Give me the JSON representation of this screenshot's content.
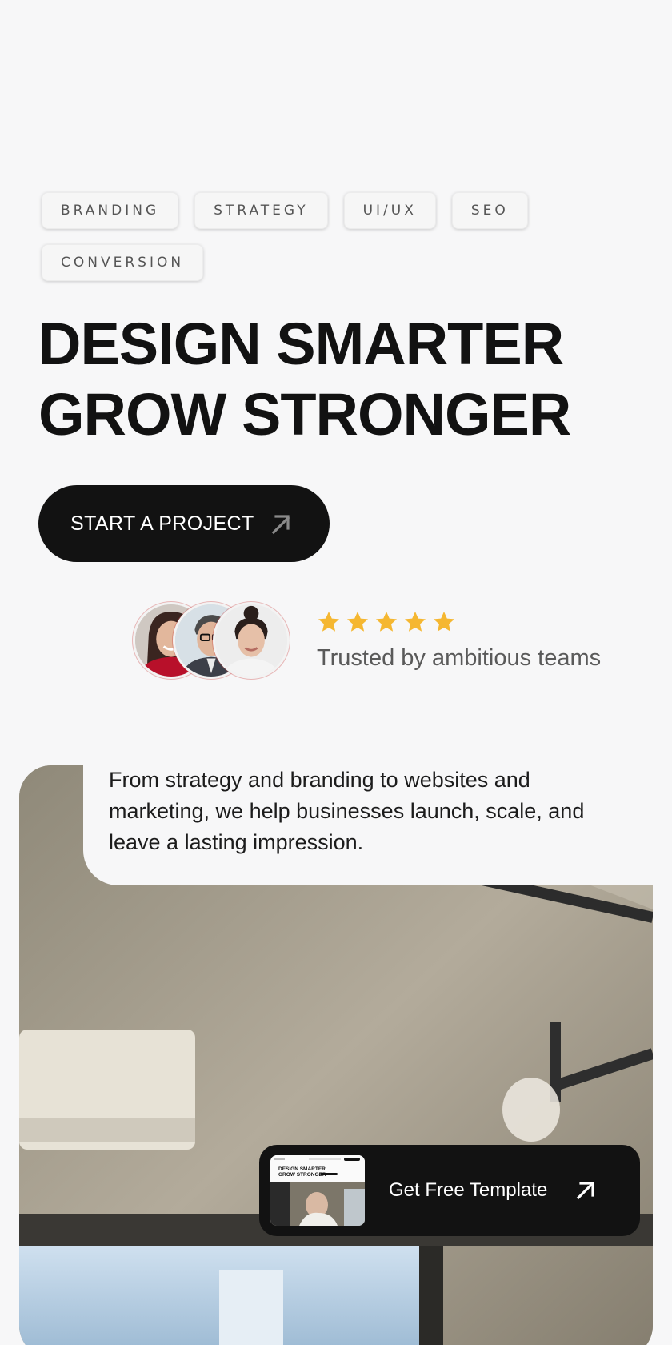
{
  "tags": [
    "BRANDING",
    "STRATEGY",
    "UI/UX",
    "SEO",
    "CONVERSION"
  ],
  "headline": {
    "line1": "DESIGN SMARTER",
    "line2": "GROW STRONGER"
  },
  "cta": {
    "label": "START A PROJECT",
    "icon": "arrow-up-right-icon"
  },
  "trust": {
    "rating": 5,
    "max_rating": 5,
    "text": "Trusted by ambitious teams",
    "star_color": "#f5b731"
  },
  "intro": "From strategy and branding to websites and marketing, we help businesses launch, scale, and leave a lasting impression.",
  "promo": {
    "label": "Get Free Template",
    "icon": "arrow-up-right-icon",
    "thumb_title_1": "DESIGN SMARTER",
    "thumb_title_2": "GROW STRONGER"
  },
  "colors": {
    "background": "#f7f7f8",
    "dark": "#121212",
    "accent_star": "#f5b731"
  }
}
